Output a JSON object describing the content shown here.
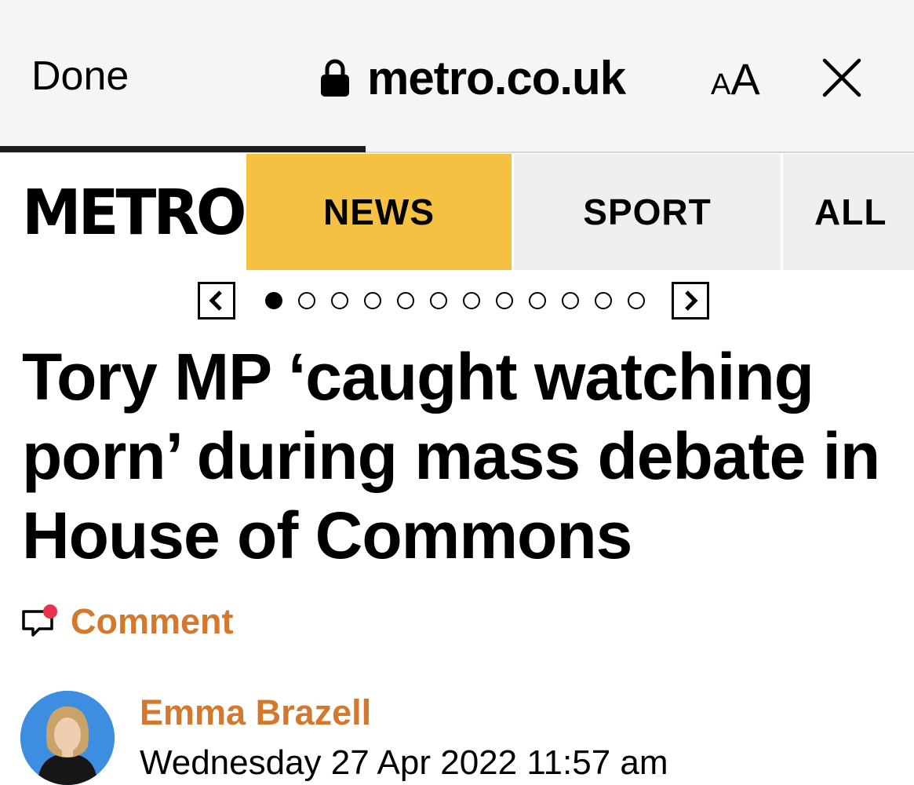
{
  "browser": {
    "done_label": "Done",
    "url": "metro.co.uk",
    "text_size_small": "A",
    "text_size_large": "A",
    "lock_icon": "lock-icon",
    "close_icon": "close-icon",
    "load_progress": 0.4
  },
  "site_nav": {
    "logo": "METRO",
    "tabs": [
      {
        "label": "NEWS",
        "active": true
      },
      {
        "label": "SPORT",
        "active": false
      },
      {
        "label": "ALL",
        "active": false
      }
    ],
    "active_color": "#f5c142"
  },
  "carousel": {
    "prev_icon": "chevron-left-icon",
    "next_icon": "chevron-right-icon",
    "total_slides": 12,
    "current_slide": 1
  },
  "article": {
    "headline": "Tory MP ‘caught watching porn’ during mass debate in House of Commons",
    "comment_label": "Comment",
    "comment_icon": "speech-bubble-icon",
    "author_name": "Emma Brazell",
    "published": "Wednesday 27 Apr 2022 11:57 am",
    "accent_color": "#d4782e"
  }
}
